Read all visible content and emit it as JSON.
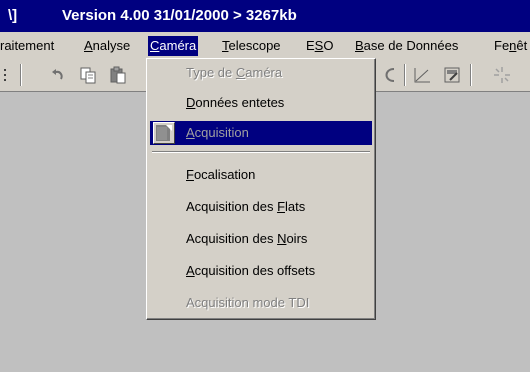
{
  "title": {
    "left": "\\]",
    "main": "Version 4.00   31/01/2000 > 3267kb"
  },
  "menubar": {
    "items": [
      {
        "pre": "raitement",
        "mn": "",
        "post": ""
      },
      {
        "pre": "",
        "mn": "A",
        "post": "nalyse"
      },
      {
        "pre": "",
        "mn": "C",
        "post": "améra"
      },
      {
        "pre": "",
        "mn": "T",
        "post": "elescope"
      },
      {
        "pre": "E",
        "mn": "S",
        "post": "O"
      },
      {
        "pre": "",
        "mn": "B",
        "post": "ase de Données"
      },
      {
        "pre": "Fe",
        "mn": "n",
        "post": "êt"
      }
    ]
  },
  "camera_menu": {
    "items": [
      {
        "pre": "Type de ",
        "mn": "C",
        "post": "améra",
        "state": "disabled"
      },
      {
        "pre": "",
        "mn": "D",
        "post": "onnées entetes",
        "state": "normal"
      },
      {
        "pre": "",
        "mn": "A",
        "post": "cquisition",
        "state": "highlighted"
      },
      {
        "pre": "",
        "mn": "F",
        "post": "ocalisation",
        "state": "normal"
      },
      {
        "pre": "Acquisition des ",
        "mn": "F",
        "post": "lats",
        "state": "normal"
      },
      {
        "pre": "Acquisition des ",
        "mn": "N",
        "post": "oirs",
        "state": "normal"
      },
      {
        "pre": "",
        "mn": "A",
        "post": "cquisition des offsets",
        "state": "normal"
      },
      {
        "pre": "Acquisition mode TDI",
        "mn": "",
        "post": "",
        "state": "disabled"
      }
    ]
  },
  "toolbar_icons": [
    "grip-icon",
    "undo-icon",
    "copy-icon",
    "paste-icon",
    "curve-icon",
    "line-graph-icon",
    "edit-icon",
    "sparkle-icon"
  ],
  "colors": {
    "titlebar": "#000080",
    "menu_highlight": "#000080",
    "face": "#d4d0c8",
    "workspace": "#c0c0c0"
  }
}
